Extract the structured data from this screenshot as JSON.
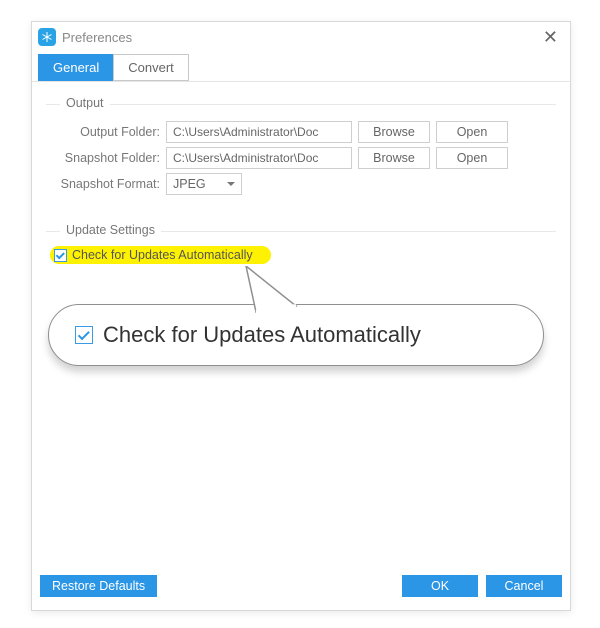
{
  "window": {
    "title": "Preferences"
  },
  "tabs": {
    "general": "General",
    "convert": "Convert"
  },
  "output": {
    "legend": "Output",
    "output_folder_label": "Output Folder:",
    "output_folder_value": "C:\\Users\\Administrator\\Doc",
    "snapshot_folder_label": "Snapshot Folder:",
    "snapshot_folder_value": "C:\\Users\\Administrator\\Doc",
    "snapshot_format_label": "Snapshot Format:",
    "snapshot_format_value": "JPEG",
    "browse": "Browse",
    "open": "Open"
  },
  "update": {
    "legend": "Update Settings",
    "auto_label": "Check for Updates Automatically"
  },
  "callout": {
    "label": "Check for Updates Automatically"
  },
  "footer": {
    "restore": "Restore Defaults",
    "ok": "OK",
    "cancel": "Cancel"
  }
}
